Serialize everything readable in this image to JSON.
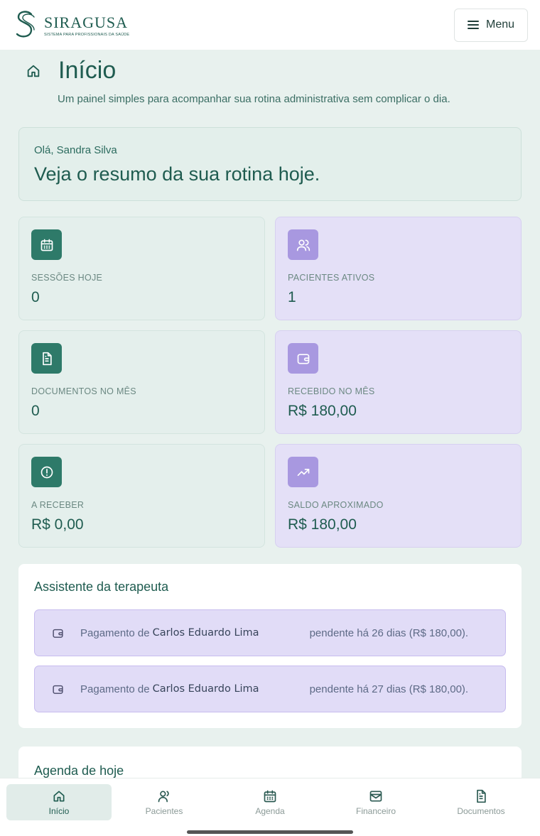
{
  "header": {
    "brand_name": "SIRAGUSA",
    "brand_tagline": "SISTEMA PARA PROFISSIONAIS DA SAÚDE",
    "menu_label": "Menu"
  },
  "page": {
    "title": "Início",
    "subtitle": "Um painel simples para acompanhar sua rotina administrativa sem complicar o dia."
  },
  "greeting": {
    "hello": "Olá, Sandra Silva",
    "headline": "Veja o resumo da sua rotina hoje."
  },
  "stats": [
    {
      "label": "SESSÕES HOJE",
      "value": "0",
      "icon": "calendar-icon",
      "tone": "green"
    },
    {
      "label": "PACIENTES ATIVOS",
      "value": "1",
      "icon": "users-icon",
      "tone": "purple"
    },
    {
      "label": "DOCUMENTOS NO MÊS",
      "value": "0",
      "icon": "document-icon",
      "tone": "green"
    },
    {
      "label": "RECEBIDO NO MÊS",
      "value": "R$ 180,00",
      "icon": "wallet-icon",
      "tone": "purple"
    },
    {
      "label": "A RECEBER",
      "value": "R$ 0,00",
      "icon": "alert-circle-icon",
      "tone": "green"
    },
    {
      "label": "SALDO APROXIMADO",
      "value": "R$ 180,00",
      "icon": "trending-up-icon",
      "tone": "purple"
    }
  ],
  "assistant": {
    "title": "Assistente da terapeuta",
    "alerts": [
      {
        "prefix": "Pagamento de",
        "name": "Carlos Eduardo Lima",
        "suffix": "pendente há 26 dias (R$ 180,00)."
      },
      {
        "prefix": "Pagamento de",
        "name": "Carlos Eduardo Lima",
        "suffix": "pendente há 27 dias (R$ 180,00)."
      }
    ]
  },
  "agenda": {
    "title": "Agenda de hoje"
  },
  "nav": [
    {
      "label": "Início",
      "icon": "home-icon",
      "active": true
    },
    {
      "label": "Pacientes",
      "icon": "user-icon",
      "active": false
    },
    {
      "label": "Agenda",
      "icon": "calendar-icon",
      "active": false
    },
    {
      "label": "Financeiro",
      "icon": "inbox-icon",
      "active": false
    },
    {
      "label": "Documentos",
      "icon": "document-icon",
      "active": false
    }
  ],
  "colors": {
    "primary": "#1f5c50",
    "green_icon_bg": "#2e7a69",
    "purple_icon_bg": "#a898e0",
    "purple_card_bg": "#e4e0f7",
    "page_bg": "#e8f1ee"
  }
}
